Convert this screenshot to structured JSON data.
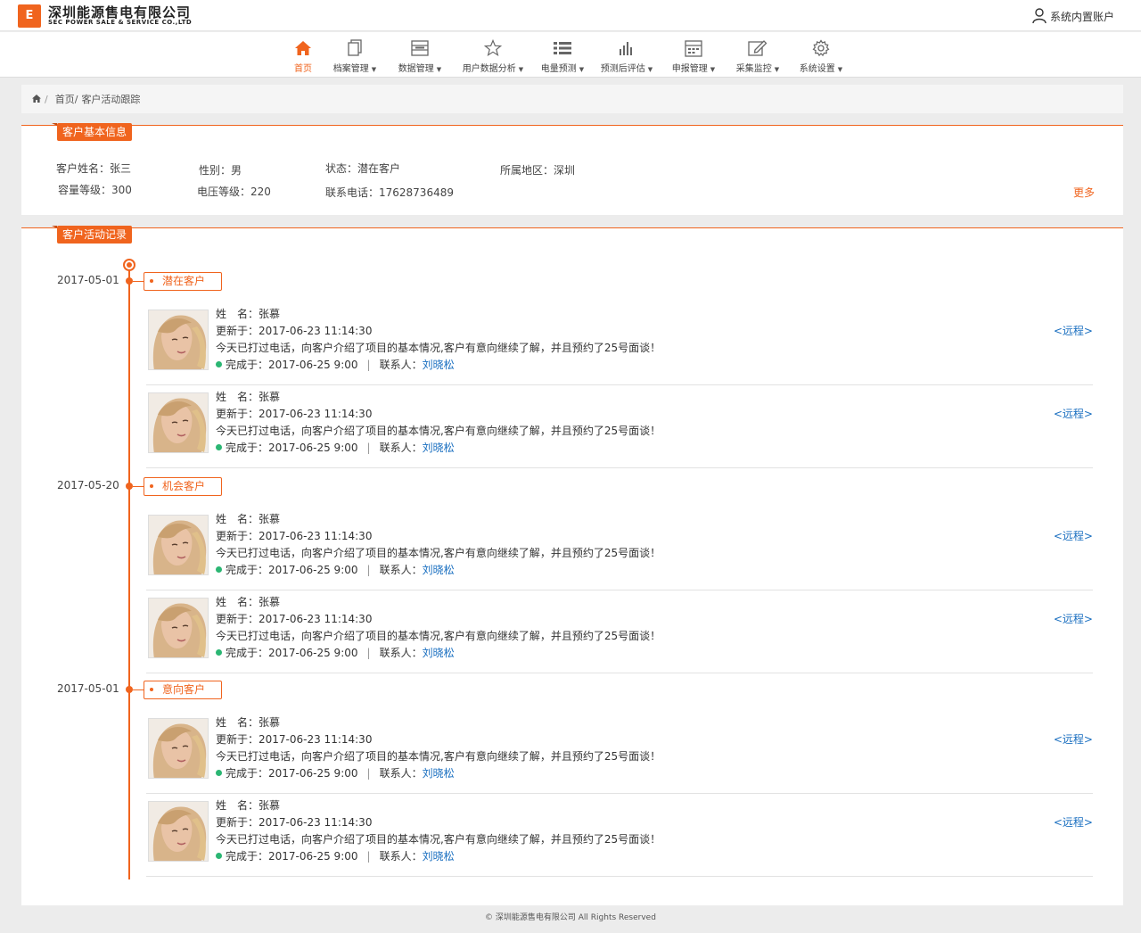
{
  "header": {
    "logo_text": "E",
    "company_cn": "深圳能源售电有限公司",
    "company_en": "SEC POWER SALE & SERVICE CO.,LTD",
    "account": "系统内置账户"
  },
  "nav": [
    {
      "label": "首页",
      "icon": "home-icon",
      "active": true,
      "dropdown": false
    },
    {
      "label": "档案管理",
      "icon": "files-icon",
      "dropdown": true
    },
    {
      "label": "数据管理",
      "icon": "database-icon",
      "dropdown": true
    },
    {
      "label": "用户数据分析",
      "icon": "star-icon",
      "dropdown": true
    },
    {
      "label": "电量预测",
      "icon": "list-icon",
      "dropdown": true
    },
    {
      "label": "预测后评估",
      "icon": "bar-chart-icon",
      "dropdown": true
    },
    {
      "label": "申报管理",
      "icon": "calendar-icon",
      "dropdown": true
    },
    {
      "label": "采集监控",
      "icon": "edit-icon",
      "dropdown": true
    },
    {
      "label": "系统设置",
      "icon": "gear-icon",
      "dropdown": true
    }
  ],
  "breadcrumb": {
    "home": "首页/",
    "current": "客户活动跟踪"
  },
  "basic_info": {
    "title": "客户基本信息",
    "name": "客户姓名：张三",
    "gender": "性别：男",
    "status": "状态：潜在客户",
    "region": "所属地区：深圳",
    "capacity": "容量等级：300",
    "voltage": "电压等级：220",
    "phone": "联系电话：17628736489",
    "more": "更多"
  },
  "activity": {
    "title": "客户活动记录",
    "groups": [
      {
        "date": "2017-05-01",
        "stage": "潜在客户"
      },
      {
        "date": "2017-05-20",
        "stage": "机会客户"
      },
      {
        "date": "2017-05-01",
        "stage": "意向客户"
      }
    ],
    "entry": {
      "name": "姓　名：张慕",
      "updated": "更新于：2017-06-23  11:14:30",
      "desc": "今天已打过电话，向客户介绍了项目的基本情况,客户有意向继续了解，并且预约了25号面谈！",
      "done": "完成于：2017-06-25  9:00",
      "contact_label": "联系人：",
      "contact": "刘晓松",
      "remote": "<远程>"
    }
  },
  "footer": "© 深圳能源售电有限公司 All Rights Reserved",
  "colors": {
    "accent": "#f0641e",
    "link": "#1a6fc0",
    "done": "#2bb673"
  }
}
